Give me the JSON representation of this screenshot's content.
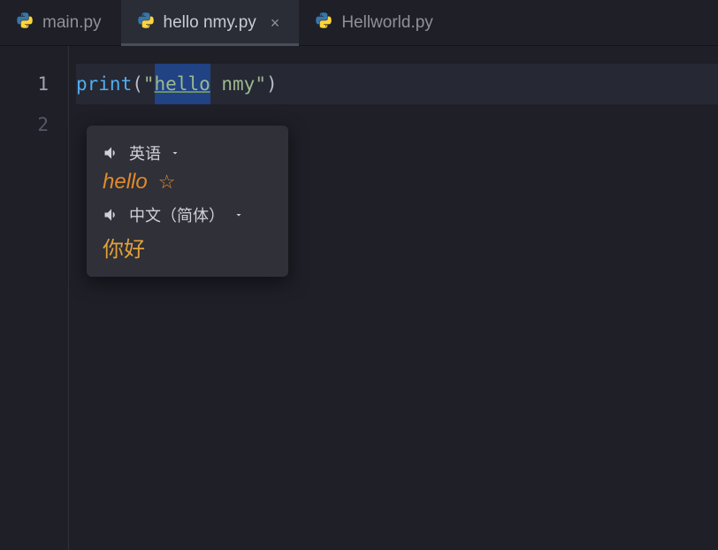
{
  "tabs": [
    {
      "label": "main.py"
    },
    {
      "label": "hello nmy.py"
    },
    {
      "label": "Hellworld.py"
    }
  ],
  "active_tab_index": 1,
  "gutter": {
    "ln1": "1",
    "ln2": "2"
  },
  "code": {
    "func": "print",
    "open": "(",
    "q1": "\"",
    "sel": "hello",
    "rest": " nmy",
    "q2": "\"",
    "close": ")"
  },
  "popup": {
    "src_lang": "英语",
    "word": "hello",
    "dst_lang": "中文（简体）",
    "translation": "你好"
  }
}
